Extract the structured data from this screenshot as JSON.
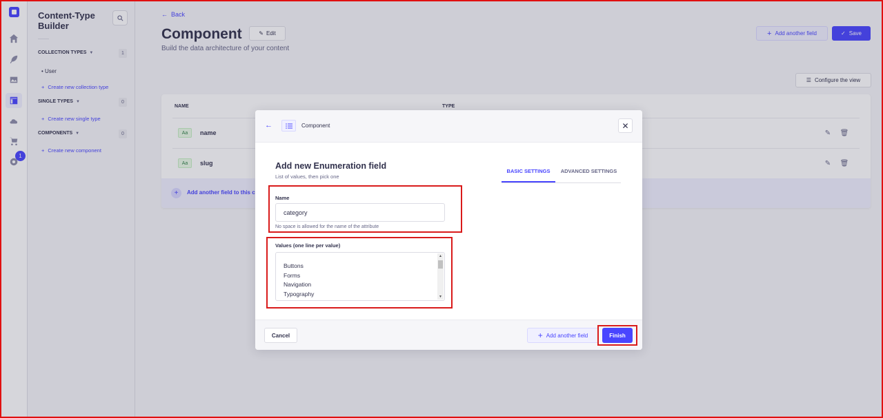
{
  "rail": {
    "badge_count": "1"
  },
  "subnav": {
    "title": "Content-Type Builder",
    "collection_types": {
      "label": "COLLECTION TYPES",
      "count": "1",
      "items": [
        "User"
      ],
      "create_label": "Create new collection type"
    },
    "single_types": {
      "label": "SINGLE TYPES",
      "count": "0",
      "create_label": "Create new single type"
    },
    "components": {
      "label": "COMPONENTS",
      "count": "0",
      "create_label": "Create new component"
    }
  },
  "header": {
    "back_label": "Back",
    "title": "Component",
    "edit_label": "Edit",
    "subtitle": "Build the data architecture of your content",
    "add_field_label": "Add another field",
    "save_label": "Save",
    "configure_label": "Configure the view"
  },
  "table": {
    "headers": {
      "name": "NAME",
      "type": "TYPE"
    },
    "rows": [
      {
        "badge": "Aa",
        "name": "name"
      },
      {
        "badge": "Aa",
        "name": "slug"
      }
    ],
    "add_field_label": "Add another field to this co"
  },
  "modal": {
    "breadcrumb": "Component",
    "title": "Add new Enumeration field",
    "subtitle": "List of values, then pick one",
    "tabs": {
      "basic": "BASIC SETTINGS",
      "advanced": "ADVANCED SETTINGS"
    },
    "name_field": {
      "label": "Name",
      "value": "category",
      "hint": "No space is allowed for the name of the attribute"
    },
    "values_field": {
      "label": "Values (one line per value)",
      "lines": [
        "Buttons",
        "Forms",
        "Navigation",
        "Typography"
      ]
    },
    "footer": {
      "cancel_label": "Cancel",
      "add_another_label": "Add another field",
      "finish_label": "Finish"
    }
  },
  "colors": {
    "accent": "#4945ff",
    "highlight": "#d91a1a"
  }
}
